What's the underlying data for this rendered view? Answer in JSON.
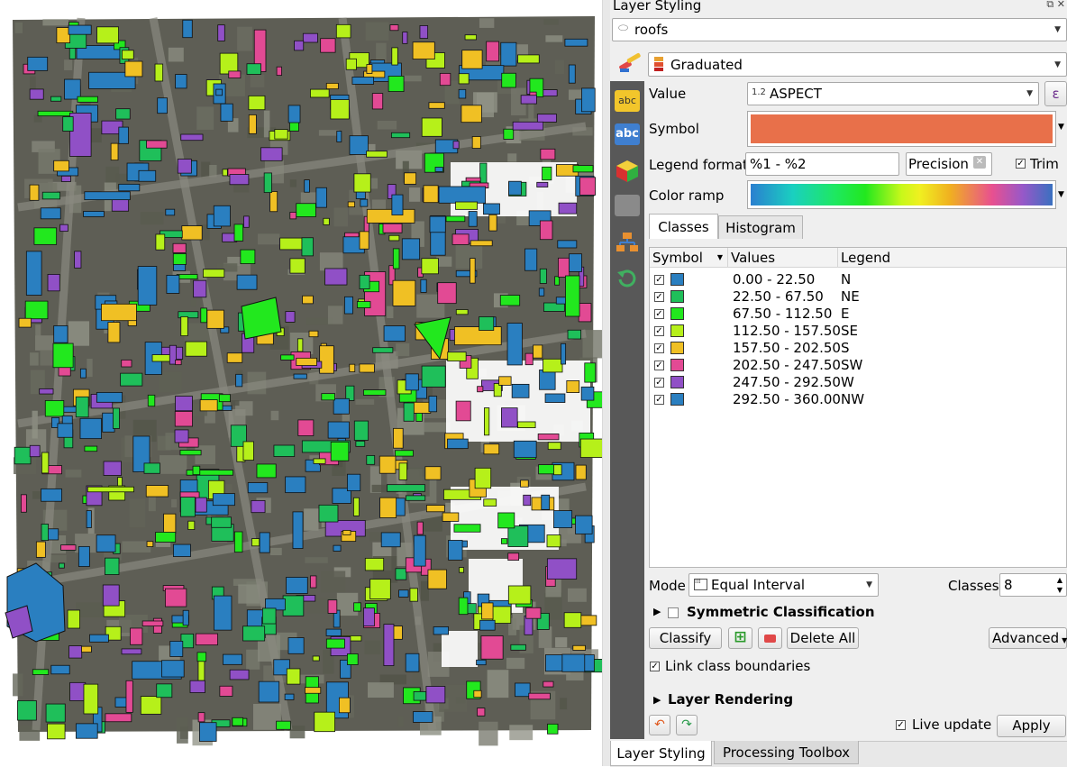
{
  "panel": {
    "title": "Layer Styling",
    "layer_name": "roofs",
    "renderer": "Graduated",
    "value_prefix": "1.2",
    "value_field": "ASPECT",
    "expression_icon": "ε",
    "labels": {
      "value": "Value",
      "symbol": "Symbol",
      "legend_format": "Legend format",
      "color_ramp": "Color ramp",
      "trim": "Trim"
    },
    "symbol_color": "#e8704a",
    "legend_format_value": "%1 - %2",
    "precision_value": "Precision 0"
  },
  "tabs": {
    "classes": "Classes",
    "histogram": "Histogram"
  },
  "table": {
    "headers": {
      "symbol": "Symbol",
      "values": "Values",
      "legend": "Legend"
    },
    "rows": [
      {
        "values": "0.00 - 22.50",
        "legend": "N",
        "color": "#2a7fc0"
      },
      {
        "values": "22.50 - 67.50",
        "legend": "NE",
        "color": "#1fbf5a"
      },
      {
        "values": "67.50 - 112.50",
        "legend": "E",
        "color": "#22e81e"
      },
      {
        "values": "112.50 - 157.50",
        "legend": "SE",
        "color": "#b6f01a"
      },
      {
        "values": "157.50 - 202.50",
        "legend": "S",
        "color": "#f0c024"
      },
      {
        "values": "202.50 - 247.50",
        "legend": "SW",
        "color": "#e24a94"
      },
      {
        "values": "247.50 - 292.50",
        "legend": "W",
        "color": "#9050c6"
      },
      {
        "values": "292.50 - 360.00",
        "legend": "NW",
        "color": "#2a7fc0"
      }
    ]
  },
  "mode": {
    "label": "Mode",
    "value": "Equal Interval"
  },
  "classes": {
    "label": "Classes",
    "value": "8"
  },
  "sections": {
    "symmetric": "Symmetric Classification",
    "layer_rendering": "Layer Rendering"
  },
  "buttons": {
    "classify": "Classify",
    "delete_all": "Delete All",
    "advanced": "Advanced",
    "apply": "Apply"
  },
  "link_boundaries": "Link class boundaries",
  "live_update": "Live update",
  "bottom_tabs": {
    "layer_styling": "Layer Styling",
    "processing_toolbox": "Processing Toolbox"
  }
}
